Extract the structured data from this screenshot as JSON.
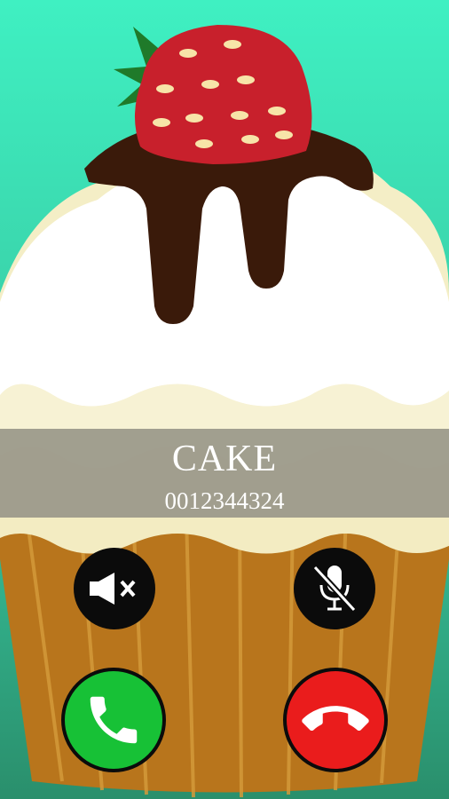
{
  "call": {
    "caller_name": "CAKE",
    "caller_number": "0012344324"
  },
  "controls": {
    "speaker_icon": "speaker-muted-icon",
    "mic_icon": "mic-off-icon",
    "answer_icon": "phone-answer-icon",
    "decline_icon": "phone-hangup-icon"
  },
  "colors": {
    "background_top": "#3ff0c0",
    "background_bottom": "#2a9a72",
    "answer": "#17c136",
    "decline": "#ea1c1c",
    "strawberry": "#c8202c",
    "chocolate": "#3a1a0a",
    "cream": "#ffffff",
    "cup": "#b8751c"
  }
}
